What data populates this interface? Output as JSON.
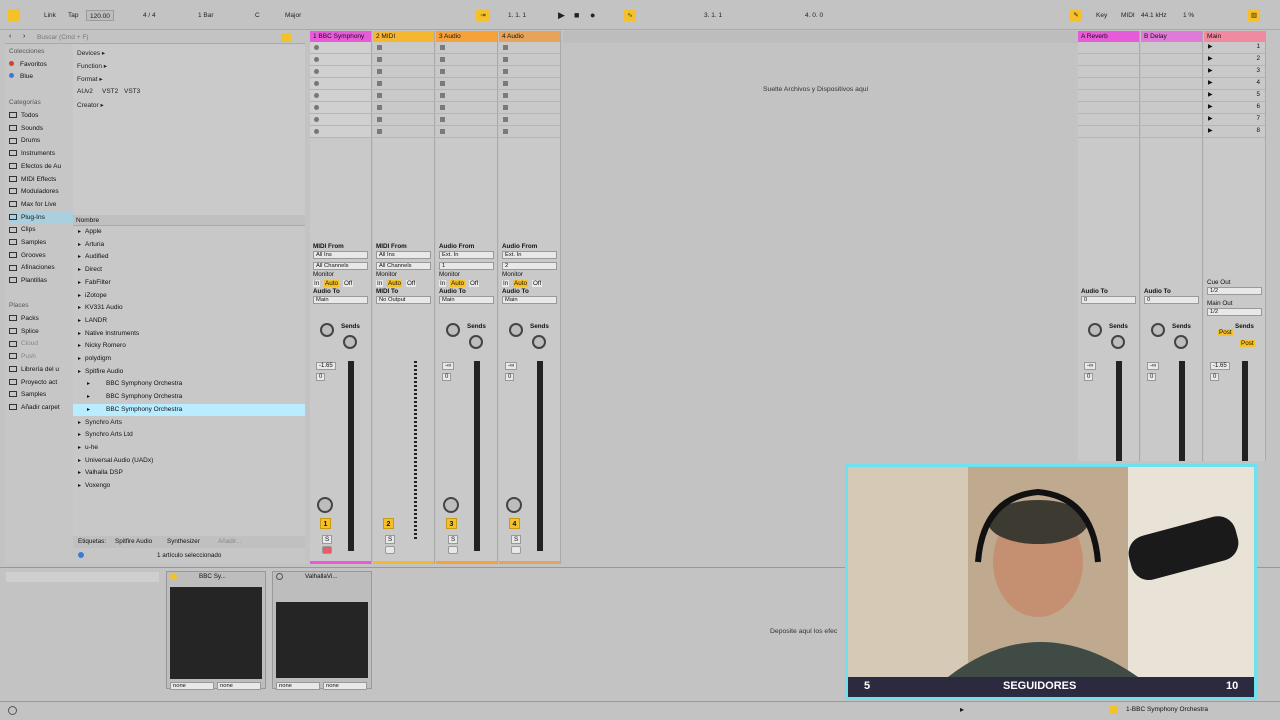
{
  "toolbar": {
    "link": "Link",
    "tap": "Tap",
    "tempo": "120.00",
    "signature": "4 / 4",
    "quantize": "1 Bar",
    "key": "C",
    "scale": "Major",
    "position": "1.   1.   1",
    "loop_start": "3.   1.   1",
    "loop_length": "4.   0.   0",
    "key_btn": "Key",
    "midi_btn": "MIDI",
    "sample_rate": "44.1 kHz",
    "cpu": "1 %"
  },
  "browser": {
    "search_placeholder": "Buscar (Cmd + F)",
    "collections_header": "Colecciones",
    "collections": [
      {
        "label": "Favoritos",
        "color": "#e23b2e"
      },
      {
        "label": "Blue",
        "color": "#3a7ad8"
      }
    ],
    "categories_header": "Categorías",
    "categories": [
      "Todos",
      "Sounds",
      "Drums",
      "Instruments",
      "Efectos de Au",
      "MIDI Effects",
      "Moduladores",
      "Max for Live",
      "Plug-Ins",
      "Clips",
      "Samples",
      "Grooves",
      "Afinaciones",
      "Plantillas"
    ],
    "places_header": "Places",
    "places": [
      "Packs",
      "Splice",
      "Cloud",
      "Push",
      "Librería del u",
      "Proyecto act",
      "Samples",
      "Añadir carpet"
    ],
    "filters": {
      "devices": "Devices ▸",
      "function": "Function ▸",
      "format": "Format ▸",
      "formats": [
        "AUv2",
        "VST2",
        "VST3"
      ],
      "creator": "Creator ▸"
    },
    "name_header": "Nombre",
    "tree": [
      "Apple",
      "Arturia",
      "Audified",
      "Direct",
      "FabFilter",
      "iZotope",
      "KV331 Audio",
      "LANDR",
      "Native Instruments",
      "Nicky Romero",
      "polydigm",
      "Spitfire Audio",
      "BBC Symphony Orchestra",
      "BBC Symphony Orchestra",
      "BBC Symphony Orchestra",
      "Synchro Arts",
      "Synchro Arts Ltd",
      "u-he",
      "Universal Audio (UADx)",
      "Valhalla DSP",
      "Voxengo"
    ],
    "tags_label": "Etiquetas:",
    "tags": [
      "Spitfire Audio",
      "Synthesizer",
      "Añadir..."
    ],
    "status": "1 artículo seleccionado"
  },
  "tracks": [
    {
      "name": "1 BBC Symphony",
      "color": "#e85bd8",
      "from_label": "MIDI From",
      "from": "All Ins",
      "channel": "All Channels",
      "to_label": "Audio To",
      "to": "Main",
      "vol": "-1.65",
      "pan": "0",
      "number": "1"
    },
    {
      "name": "2 MIDI",
      "color": "#f5b731",
      "from_label": "MIDI From",
      "from": "All Ins",
      "channel": "All Channels",
      "to_label": "MIDI To",
      "to": "No Output",
      "vol": "",
      "pan": "",
      "number": "2"
    },
    {
      "name": "3 Audio",
      "color": "#f5a23a",
      "from_label": "Audio From",
      "from": "Ext. In",
      "channel": "1",
      "to_label": "Audio To",
      "to": "Main",
      "vol": "-∞",
      "pan": "0",
      "number": "3"
    },
    {
      "name": "4 Audio",
      "color": "#e6a45a",
      "from_label": "Audio From",
      "from": "Ext. In",
      "channel": "2",
      "to_label": "Audio To",
      "to": "Main",
      "vol": "-∞",
      "pan": "0",
      "number": "4"
    }
  ],
  "returns": [
    {
      "name": "A Reverb",
      "color": "#e85bd8",
      "vol": "-∞",
      "pan": "0"
    },
    {
      "name": "B Delay",
      "color": "#e07ad8",
      "vol": "-∞",
      "pan": "0"
    },
    {
      "name": "Main",
      "color": "#f08aa0",
      "vol": "-1.65",
      "pan": "0"
    }
  ],
  "main_scenes": [
    "1",
    "2",
    "3",
    "4",
    "5",
    "6",
    "7",
    "8"
  ],
  "mixer": {
    "monitor": "Monitor",
    "in": "In",
    "auto": "Auto",
    "off": "Off",
    "sends": "Sends",
    "cue_out": "Cue Out",
    "main_out": "Main Out",
    "cue_val": "1/2",
    "main_val": "1/2",
    "post": "Post",
    "s": "S"
  },
  "drop_text": "Suelte Archivos y Dispositivos aquí",
  "detail": {
    "device1": "BBC Sy...",
    "device2": "ValhallaVi...",
    "drop_fx": "Deposite aquí los efec",
    "none": "none"
  },
  "status_bar": {
    "track": "1-BBC Symphony Orchestra"
  },
  "overlay": {
    "left": "5",
    "label": "SEGUIDORES",
    "right": "10"
  }
}
